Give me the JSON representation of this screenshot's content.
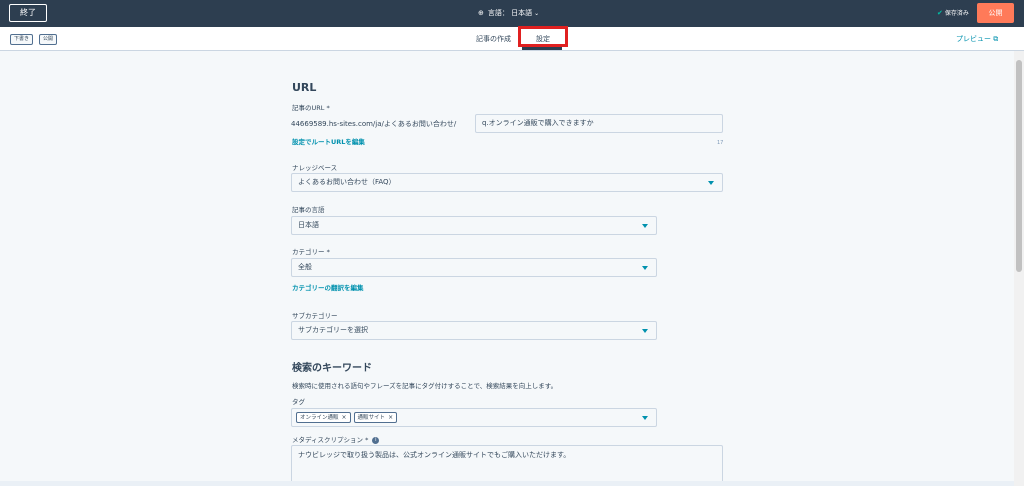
{
  "header": {
    "exit_label": "終了",
    "language_label": "言語：",
    "language_value": "日本語",
    "saved_label": "保存済み",
    "publish_label": "公開"
  },
  "subheader": {
    "draft_chip": "下書き",
    "published_chip": "公開",
    "tabs": [
      {
        "label": "記事の作成",
        "active": false
      },
      {
        "label": "設定",
        "active": true
      }
    ],
    "preview_label": "プレビュー"
  },
  "form": {
    "url_heading": "URL",
    "article_url_label": "記事のURL",
    "required_mark": "*",
    "url_prefix": "44669589.hs-sites.com/ja/よくあるお問い合わせ/",
    "url_slug_value": "q.オンライン通販で購入できますか",
    "edit_root_url_link": "設定でルートURLを編集",
    "slug_char_count": "17",
    "knowledge_base_label": "ナレッジベース",
    "knowledge_base_value": "よくあるお問い合わせ（FAQ）",
    "article_language_label": "記事の言語",
    "article_language_value": "日本語",
    "category_label": "カテゴリー",
    "category_value": "全般",
    "edit_category_translation_link": "カテゴリーの翻訳を編集",
    "subcategory_label": "サブカテゴリー",
    "subcategory_placeholder": "サブカテゴリーを選択",
    "search_keywords_heading": "検索のキーワード",
    "search_keywords_description": "検索時に使用される語句やフレーズを記事にタグ付けすることで、検索結果を向上します。",
    "tags_label": "タグ",
    "tags": [
      "オンライン通販",
      "通販サイト"
    ],
    "meta_description_label": "メタディスクリプション",
    "meta_description_value": "ナウビレッジで取り扱う製品は、公式オンライン通販サイトでもご購入いただけます。"
  },
  "colors": {
    "topbar": "#2d3e50",
    "accent_orange": "#ff7a59",
    "link_teal": "#0091ae",
    "highlight_red": "#e02020"
  }
}
